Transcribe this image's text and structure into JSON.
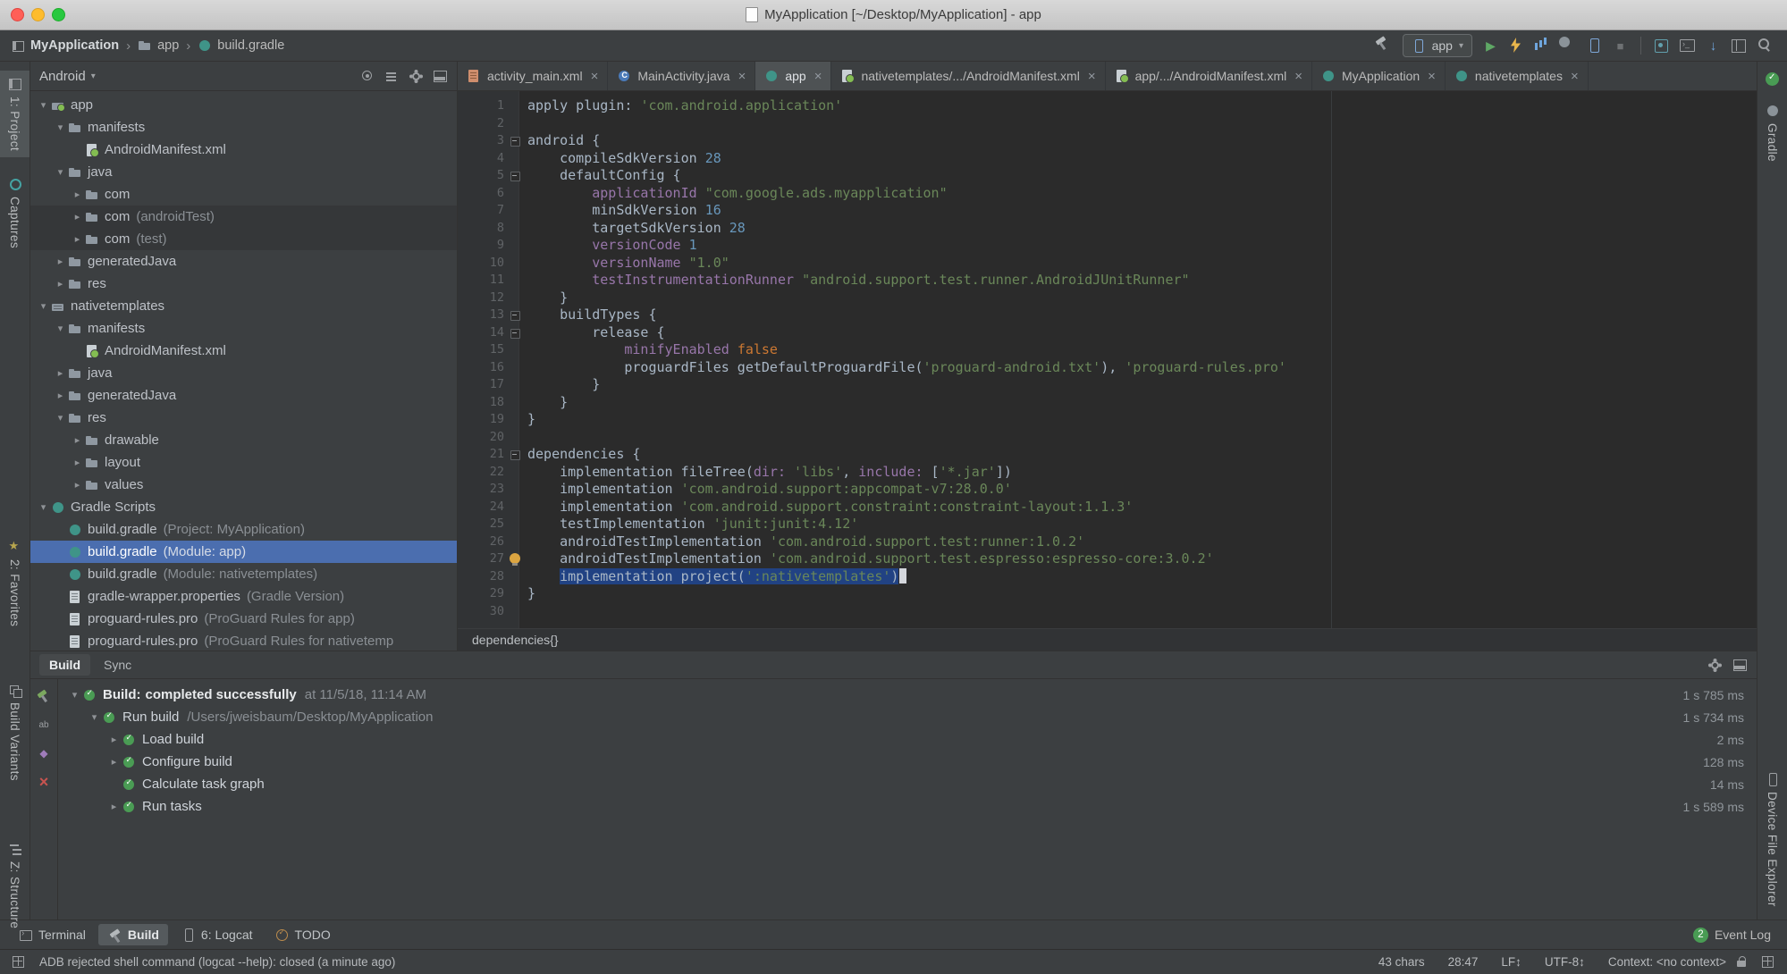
{
  "window": {
    "title": "MyApplication [~/Desktop/MyApplication] - app"
  },
  "navbar": {
    "crumbs": [
      {
        "icon": "project-icon",
        "label": "MyApplication"
      },
      {
        "icon": "folder-icon",
        "label": "app"
      },
      {
        "icon": "gradle-icon",
        "label": "build.gradle"
      }
    ],
    "run_config": "app"
  },
  "strips": {
    "left": [
      {
        "icon": "project-tool-icon",
        "label": "1: Project",
        "active": true
      },
      {
        "icon": "captures-icon",
        "label": "Captures"
      },
      {
        "icon": "favorites-star-icon",
        "label": "2: Favorites"
      },
      {
        "icon": "build-variants-icon",
        "label": "Build Variants"
      },
      {
        "icon": "structure-icon",
        "label": "Z: Structure"
      }
    ],
    "right": [
      {
        "icon": "gradle-elephant-icon",
        "label": "Gradle"
      },
      {
        "icon": "device-file-explorer-icon",
        "label": "Device File Explorer"
      }
    ]
  },
  "project": {
    "view": "Android",
    "tree": [
      {
        "indent": 0,
        "expand": "open",
        "icon": "android-module-folder-icon",
        "label": "app"
      },
      {
        "indent": 1,
        "expand": "open",
        "icon": "folder-icon",
        "label": "manifests"
      },
      {
        "indent": 2,
        "icon": "manifest-file-icon",
        "label": "AndroidManifest.xml"
      },
      {
        "indent": 1,
        "expand": "open",
        "icon": "folder-icon",
        "label": "java"
      },
      {
        "indent": 2,
        "expand": "closed",
        "icon": "package-icon",
        "label": "com"
      },
      {
        "indent": 2,
        "expand": "closed",
        "icon": "package-icon",
        "label": "com",
        "suffix": "(androidTest)",
        "shaded": true
      },
      {
        "indent": 2,
        "expand": "closed",
        "icon": "package-icon",
        "label": "com",
        "suffix": "(test)",
        "shaded": true
      },
      {
        "indent": 1,
        "expand": "closed",
        "icon": "generated-folder-icon",
        "label": "generatedJava"
      },
      {
        "indent": 1,
        "expand": "closed",
        "icon": "res-folder-icon",
        "label": "res"
      },
      {
        "indent": 0,
        "expand": "open",
        "icon": "library-module-folder-icon",
        "label": "nativetemplates"
      },
      {
        "indent": 1,
        "expand": "open",
        "icon": "folder-icon",
        "label": "manifests"
      },
      {
        "indent": 2,
        "icon": "manifest-file-icon",
        "label": "AndroidManifest.xml"
      },
      {
        "indent": 1,
        "expand": "closed",
        "icon": "folder-icon",
        "label": "java"
      },
      {
        "indent": 1,
        "expand": "closed",
        "icon": "generated-folder-icon",
        "label": "generatedJava"
      },
      {
        "indent": 1,
        "expand": "open",
        "icon": "res-folder-icon",
        "label": "res"
      },
      {
        "indent": 2,
        "expand": "closed",
        "icon": "drawable-folder-icon",
        "label": "drawable"
      },
      {
        "indent": 2,
        "expand": "closed",
        "icon": "layout-folder-icon",
        "label": "layout"
      },
      {
        "indent": 2,
        "expand": "closed",
        "icon": "values-folder-icon",
        "label": "values"
      },
      {
        "indent": 0,
        "expand": "open",
        "icon": "gradle-icon",
        "label": "Gradle Scripts"
      },
      {
        "indent": 1,
        "icon": "gradle-icon",
        "label": "build.gradle",
        "suffix": "(Project: MyApplication)"
      },
      {
        "indent": 1,
        "icon": "gradle-icon",
        "label": "build.gradle",
        "suffix": "(Module: app)",
        "selected": true
      },
      {
        "indent": 1,
        "icon": "gradle-icon",
        "label": "build.gradle",
        "suffix": "(Module: nativetemplates)"
      },
      {
        "indent": 1,
        "icon": "properties-file-icon",
        "label": "gradle-wrapper.properties",
        "suffix": "(Gradle Version)"
      },
      {
        "indent": 1,
        "icon": "proguard-file-icon",
        "label": "proguard-rules.pro",
        "suffix": "(ProGuard Rules for app)"
      },
      {
        "indent": 1,
        "icon": "proguard-file-icon",
        "label": "proguard-rules.pro",
        "suffix": "(ProGuard Rules for nativetemp"
      }
    ]
  },
  "tabs": [
    {
      "icon": "layout-xml-icon",
      "label": "activity_main.xml"
    },
    {
      "icon": "java-class-icon",
      "label": "MainActivity.java"
    },
    {
      "icon": "gradle-icon",
      "label": "app",
      "active": true
    },
    {
      "icon": "manifest-file-icon",
      "label": "nativetemplates/.../AndroidManifest.xml"
    },
    {
      "icon": "manifest-file-icon",
      "label": "app/.../AndroidManifest.xml"
    },
    {
      "icon": "gradle-icon",
      "label": "MyApplication"
    },
    {
      "icon": "gradle-icon",
      "label": "nativetemplates"
    }
  ],
  "editor": {
    "breadcrumb": "dependencies{}",
    "lines": [
      {
        "segs": [
          [
            "d",
            "apply plugin: "
          ],
          [
            "s",
            "'com.android.application'"
          ]
        ]
      },
      {
        "segs": []
      },
      {
        "fold": true,
        "segs": [
          [
            "d",
            "android {"
          ]
        ]
      },
      {
        "segs": [
          [
            "d",
            "    compileSdkVersion "
          ],
          [
            "n",
            "28"
          ]
        ]
      },
      {
        "fold": true,
        "segs": [
          [
            "d",
            "    defaultConfig {"
          ]
        ]
      },
      {
        "segs": [
          [
            "d",
            "        "
          ],
          [
            "p",
            "applicationId"
          ],
          [
            "d",
            " "
          ],
          [
            "s",
            "\"com.google.ads.myapplication\""
          ]
        ]
      },
      {
        "segs": [
          [
            "d",
            "        minSdkVersion "
          ],
          [
            "n",
            "16"
          ]
        ]
      },
      {
        "segs": [
          [
            "d",
            "        targetSdkVersion "
          ],
          [
            "n",
            "28"
          ]
        ]
      },
      {
        "segs": [
          [
            "d",
            "        "
          ],
          [
            "p",
            "versionCode"
          ],
          [
            "d",
            " "
          ],
          [
            "n",
            "1"
          ]
        ]
      },
      {
        "segs": [
          [
            "d",
            "        "
          ],
          [
            "p",
            "versionName"
          ],
          [
            "d",
            " "
          ],
          [
            "s",
            "\"1.0\""
          ]
        ]
      },
      {
        "segs": [
          [
            "d",
            "        "
          ],
          [
            "p",
            "testInstrumentationRunner"
          ],
          [
            "d",
            " "
          ],
          [
            "s",
            "\"android.support.test.runner.AndroidJUnitRunner\""
          ]
        ]
      },
      {
        "segs": [
          [
            "d",
            "    }"
          ]
        ]
      },
      {
        "fold": true,
        "segs": [
          [
            "d",
            "    buildTypes {"
          ]
        ]
      },
      {
        "fold": true,
        "segs": [
          [
            "d",
            "        release {"
          ]
        ]
      },
      {
        "segs": [
          [
            "d",
            "            "
          ],
          [
            "p",
            "minifyEnabled"
          ],
          [
            "d",
            " "
          ],
          [
            "k",
            "false"
          ]
        ]
      },
      {
        "segs": [
          [
            "d",
            "            proguardFiles getDefaultProguardFile("
          ],
          [
            "s",
            "'proguard-android.txt'"
          ],
          [
            "d",
            "), "
          ],
          [
            "s",
            "'proguard-rules.pro'"
          ]
        ]
      },
      {
        "segs": [
          [
            "d",
            "        }"
          ]
        ]
      },
      {
        "segs": [
          [
            "d",
            "    }"
          ]
        ]
      },
      {
        "segs": [
          [
            "d",
            "}"
          ]
        ]
      },
      {
        "segs": []
      },
      {
        "fold": true,
        "segs": [
          [
            "d",
            "dependencies {"
          ]
        ]
      },
      {
        "segs": [
          [
            "d",
            "    implementation fileTree("
          ],
          [
            "p",
            "dir:"
          ],
          [
            "d",
            " "
          ],
          [
            "s",
            "'libs'"
          ],
          [
            "d",
            ", "
          ],
          [
            "p",
            "include:"
          ],
          [
            "d",
            " ["
          ],
          [
            "s",
            "'*.jar'"
          ],
          [
            "d",
            "])"
          ]
        ]
      },
      {
        "segs": [
          [
            "d",
            "    implementation "
          ],
          [
            "s",
            "'com.android.support:appcompat-v7:28.0.0'"
          ]
        ]
      },
      {
        "segs": [
          [
            "d",
            "    implementation "
          ],
          [
            "s",
            "'com.android.support.constraint:constraint-layout:1.1.3'"
          ]
        ]
      },
      {
        "segs": [
          [
            "d",
            "    testImplementation "
          ],
          [
            "s",
            "'junit:junit:4.12'"
          ]
        ]
      },
      {
        "segs": [
          [
            "d",
            "    androidTestImplementation "
          ],
          [
            "s",
            "'com.android.support.test:runner:1.0.2'"
          ]
        ]
      },
      {
        "bulb": true,
        "segs": [
          [
            "d",
            "    androidTestImplementation "
          ],
          [
            "s",
            "'com.android.support.test.espresso:espresso-core:3.0.2'"
          ]
        ]
      },
      {
        "cursor": true,
        "segs": [
          [
            "d",
            "    "
          ],
          [
            "d",
            "implementation project(",
            1
          ],
          [
            "s",
            "':nativetemplates'",
            1
          ],
          [
            "d",
            ")",
            1
          ]
        ]
      },
      {
        "segs": [
          [
            "d",
            "}"
          ]
        ]
      },
      {
        "segs": []
      }
    ]
  },
  "build": {
    "tabs": [
      {
        "label": "Build",
        "active": true
      },
      {
        "label": "Sync",
        "active": false
      }
    ],
    "rows": [
      {
        "indent": 0,
        "expand": "open",
        "icon": "build-success-icon",
        "bold": true,
        "title": "Build:",
        "text": "completed successfully",
        "suffix": "at 11/5/18, 11:14 AM",
        "time": "1 s 785 ms"
      },
      {
        "indent": 1,
        "expand": "open",
        "icon": "task-success-icon",
        "title": "Run build",
        "suffix": "/Users/jweisbaum/Desktop/MyApplication",
        "time": "1 s 734 ms"
      },
      {
        "indent": 2,
        "expand": "closed",
        "icon": "task-success-icon",
        "title": "Load build",
        "time": "2 ms"
      },
      {
        "indent": 2,
        "expand": "closed",
        "icon": "task-success-icon",
        "title": "Configure build",
        "time": "128 ms"
      },
      {
        "indent": 2,
        "icon": "task-success-icon",
        "title": "Calculate task graph",
        "time": "14 ms"
      },
      {
        "indent": 2,
        "expand": "closed",
        "icon": "task-success-icon",
        "title": "Run tasks",
        "time": "1 s 589 ms"
      }
    ]
  },
  "bottom_bar": {
    "items": [
      {
        "icon": "terminal-icon",
        "label": "Terminal"
      },
      {
        "icon": "build-hammer-icon",
        "label": "Build",
        "active": true
      },
      {
        "icon": "logcat-icon",
        "label": "6: Logcat"
      },
      {
        "icon": "todo-icon",
        "label": "TODO"
      }
    ],
    "event_log": {
      "badge": "2",
      "label": "Event Log"
    }
  },
  "status_bar": {
    "message": "ADB rejected shell command (logcat --help): closed (a minute ago)",
    "right": [
      "43 chars",
      "28:47",
      "LF↕",
      "UTF-8↕",
      "Context: <no context>"
    ]
  }
}
